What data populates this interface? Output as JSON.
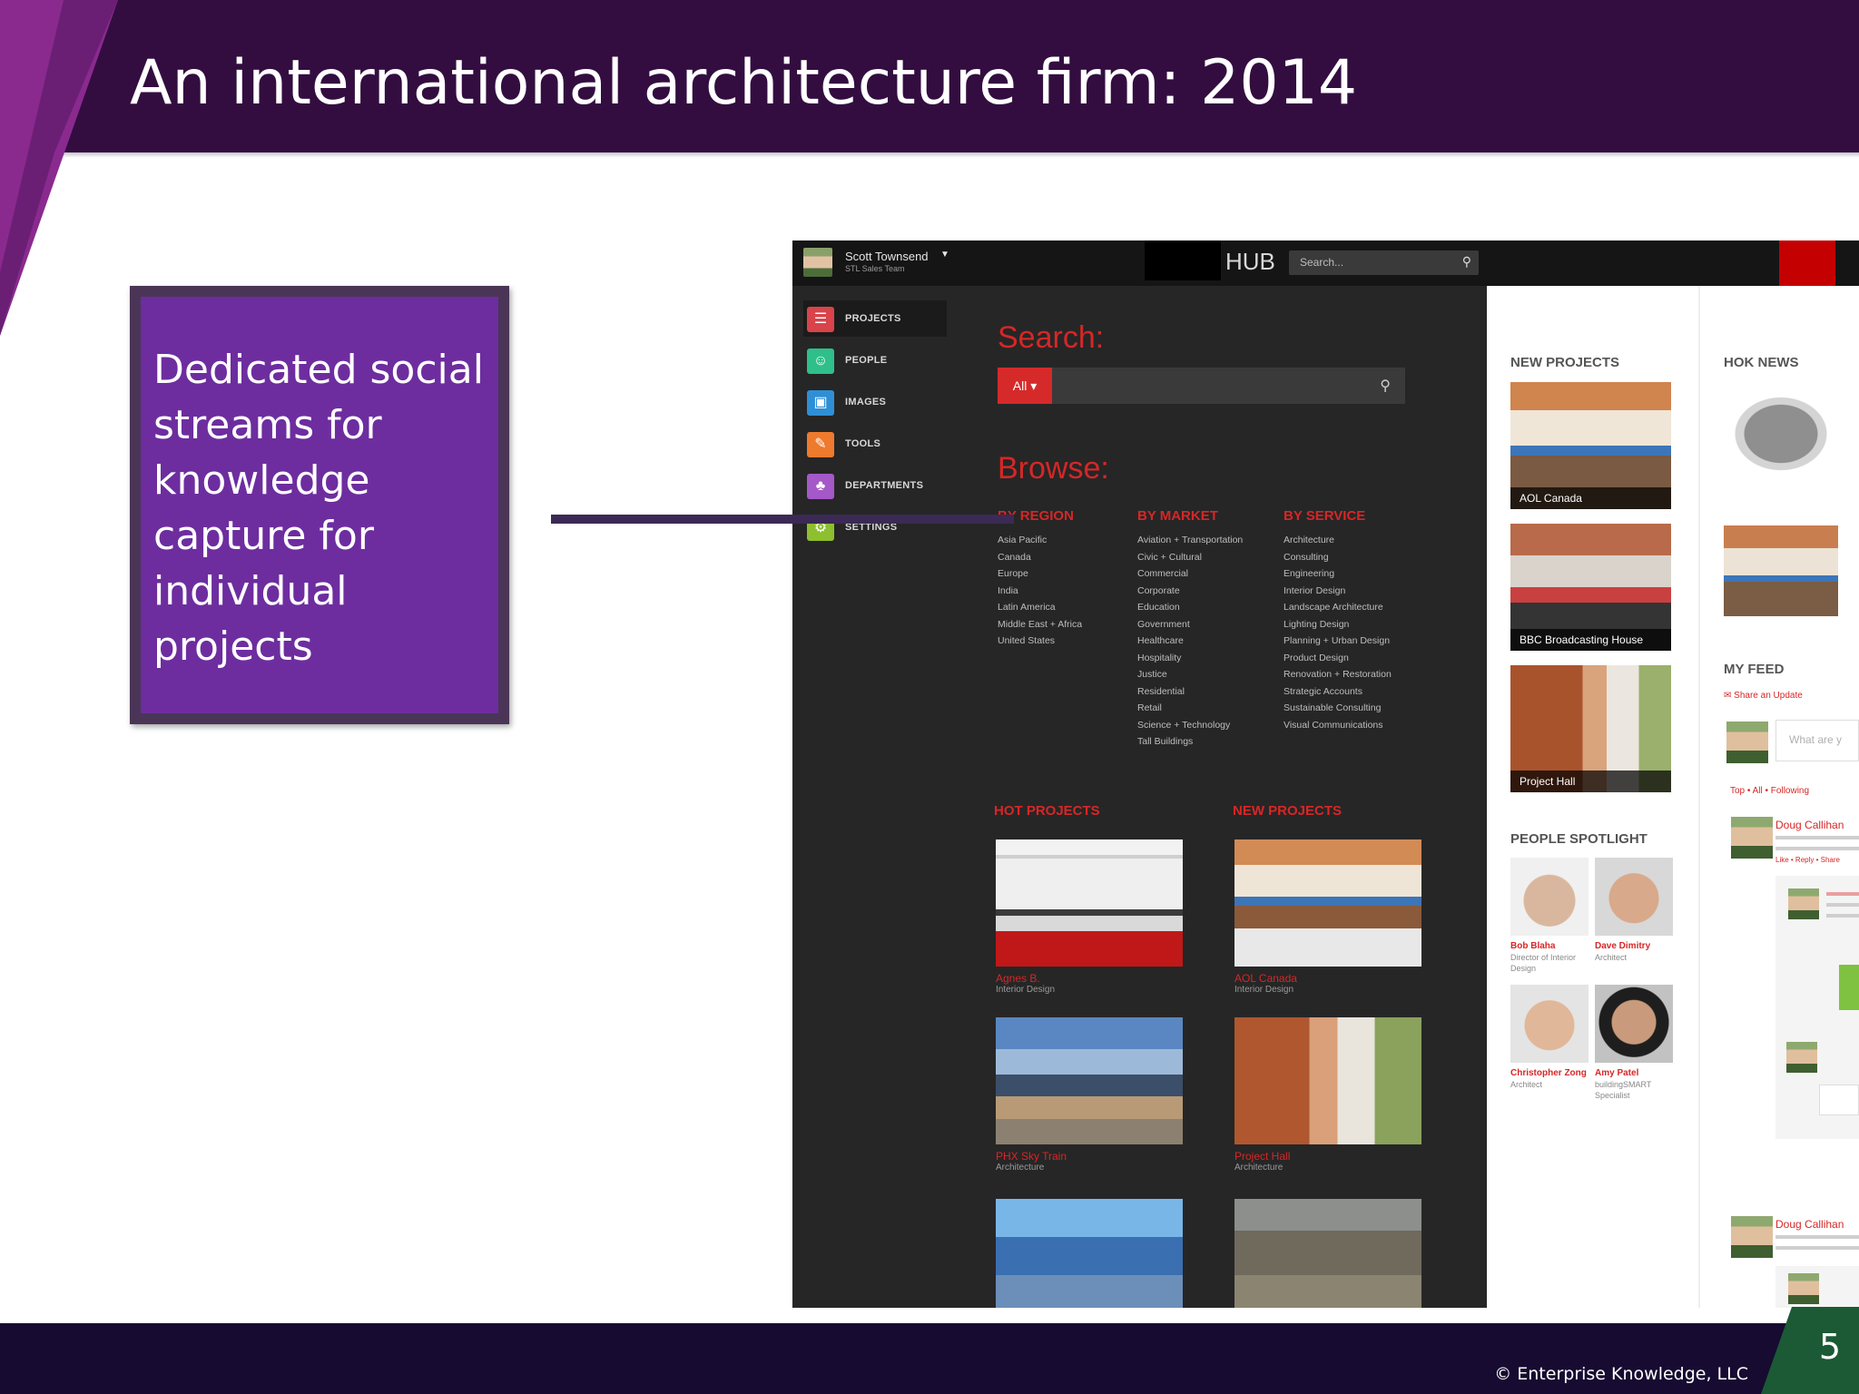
{
  "slide": {
    "title": "An international architecture firm: 2014",
    "callout_text": "Dedicated social streams for knowledge capture for individual projects",
    "page_number": "5",
    "copyright": "© Enterprise Knowledge, LLC",
    "colors": {
      "title_band": "#330d40",
      "accent_purple": "#6d2d9f",
      "footer_band": "#170b31",
      "page_wedge": "#1b5a35"
    }
  },
  "screenshot": {
    "header": {
      "user_name": "Scott Townsend",
      "user_subtitle": "STL Sales Team",
      "caret_icon": "chevron-down-icon",
      "app_name": "HUB",
      "search_placeholder": "Search...",
      "search_icon": "search-icon"
    },
    "nav": [
      {
        "label": "PROJECTS",
        "icon": "projects-icon",
        "color": "#d9434a",
        "glyph": "☰",
        "active": true
      },
      {
        "label": "PEOPLE",
        "icon": "people-icon",
        "color": "#2fbf8a",
        "glyph": "☺",
        "active": false
      },
      {
        "label": "IMAGES",
        "icon": "images-icon",
        "color": "#2f8fd6",
        "glyph": "▣",
        "active": false
      },
      {
        "label": "TOOLS",
        "icon": "tools-icon",
        "color": "#ee7a2e",
        "glyph": "✎",
        "active": false
      },
      {
        "label": "DEPARTMENTS",
        "icon": "departments-icon",
        "color": "#a558c7",
        "glyph": "♣",
        "active": false
      },
      {
        "label": "SETTINGS",
        "icon": "settings-icon",
        "color": "#8dbf2f",
        "glyph": "⚙",
        "active": false
      }
    ],
    "search": {
      "heading": "Search:",
      "scope": "All",
      "scope_icon": "chevron-down-icon"
    },
    "browse": {
      "heading": "Browse:",
      "columns": [
        {
          "title": "BY REGION",
          "items": [
            "Asia Pacific",
            "Canada",
            "Europe",
            "India",
            "Latin America",
            "Middle East + Africa",
            "United States"
          ]
        },
        {
          "title": "BY MARKET",
          "items": [
            "Aviation + Transportation",
            "Civic + Cultural",
            "Commercial",
            "Corporate",
            "Education",
            "Government",
            "Healthcare",
            "Hospitality",
            "Justice",
            "Residential",
            "Retail",
            "Science + Technology",
            "Tall Buildings"
          ]
        },
        {
          "title": "BY SERVICE",
          "items": [
            "Architecture",
            "Consulting",
            "Engineering",
            "Interior Design",
            "Landscape Architecture",
            "Lighting Design",
            "Planning + Urban Design",
            "Product Design",
            "Renovation + Restoration",
            "Strategic Accounts",
            "Sustainable Consulting",
            "Visual Communications"
          ]
        }
      ]
    },
    "hot_projects": {
      "heading": "HOT PROJECTS",
      "items": [
        {
          "name": "Agnes B.",
          "type": "Interior Design"
        },
        {
          "name": "PHX Sky Train",
          "type": "Architecture"
        }
      ]
    },
    "new_projects_main": {
      "heading": "NEW PROJECTS",
      "items": [
        {
          "name": "AOL Canada",
          "type": "Interior Design"
        },
        {
          "name": "Project Hall",
          "type": "Architecture"
        }
      ]
    },
    "new_projects_side": {
      "heading": "NEW PROJECTS",
      "cards": [
        "AOL Canada",
        "BBC Broadcasting House",
        "Project Hall"
      ]
    },
    "people_spotlight": {
      "heading": "PEOPLE SPOTLIGHT",
      "people": [
        {
          "name": "Bob Blaha",
          "role": "Director of Interior Design"
        },
        {
          "name": "Dave Dimitry",
          "role": "Architect"
        },
        {
          "name": "Christopher Zong",
          "role": "Architect"
        },
        {
          "name": "Amy Patel",
          "role": "buildingSMART Specialist"
        }
      ]
    },
    "news": {
      "heading": "HOK NEWS"
    },
    "feed": {
      "heading": "MY FEED",
      "share_update": "Share an Update",
      "share_icon": "comment-icon",
      "prompt": "What are y",
      "filters": "Top • All • Following",
      "post_author": "Doug Callihan",
      "post_author_2": "Doug Callihan",
      "reply_actions": "Like • Reply • Share"
    }
  }
}
